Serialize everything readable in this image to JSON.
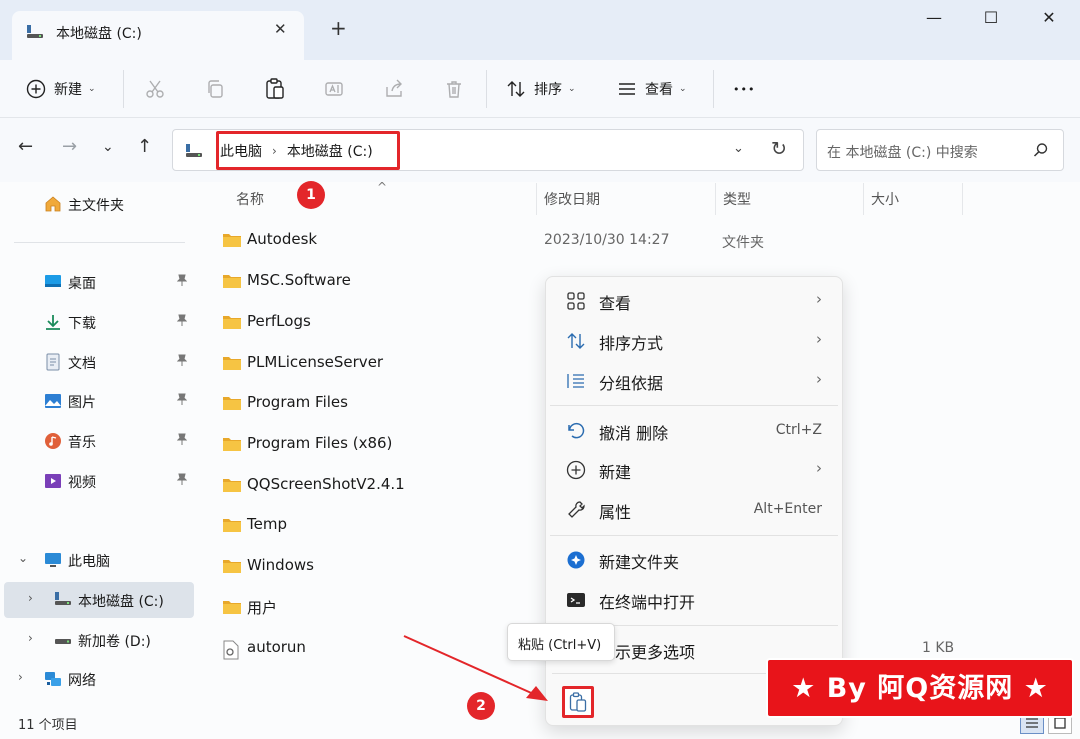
{
  "window": {
    "tab_title": "本地磁盘 (C:)",
    "tab_close": "✕",
    "new_tab": "+",
    "minimize": "—",
    "maximize": "☐",
    "close": "✕"
  },
  "toolbar": {
    "new_label": "新建",
    "sort_label": "排序",
    "view_label": "查看",
    "more_label": "•••",
    "caret": "⌄",
    "disabled_buttons": [
      "cut-icon",
      "copy-icon",
      "rename-icon",
      "share-icon",
      "delete-icon"
    ],
    "enabled_buttons": [
      "paste-icon"
    ]
  },
  "nav": {
    "back": "←",
    "forward": "→",
    "recent": "⌄",
    "up": "↑"
  },
  "address": {
    "crumbs": [
      "此电脑",
      "本地磁盘 (C:)"
    ],
    "separator": "›",
    "dropdown": "⌄",
    "refresh": "↻"
  },
  "search": {
    "placeholder": "在 本地磁盘 (C:) 中搜索"
  },
  "sidebar": {
    "home": "主文件夹",
    "quick": [
      {
        "label": "桌面",
        "icon": "desktop-icon"
      },
      {
        "label": "下载",
        "icon": "download-icon"
      },
      {
        "label": "文档",
        "icon": "document-icon"
      },
      {
        "label": "图片",
        "icon": "pictures-icon"
      },
      {
        "label": "音乐",
        "icon": "music-icon"
      },
      {
        "label": "视频",
        "icon": "video-icon"
      }
    ],
    "pin": "📌",
    "this_pc": "此电脑",
    "drive_c": "本地磁盘 (C:)",
    "drive_d": "新加卷 (D:)",
    "network": "网络",
    "expand": "›",
    "collapse": "⌄"
  },
  "columns": {
    "name": "名称",
    "modified": "修改日期",
    "type": "类型",
    "size": "大小"
  },
  "files": [
    {
      "name": "Autodesk",
      "date": "2023/10/30 14:27",
      "type": "文件夹",
      "kind": "folder"
    },
    {
      "name": "MSC.Software",
      "date": "",
      "type": "",
      "kind": "folder"
    },
    {
      "name": "PerfLogs",
      "date": "",
      "type": "",
      "kind": "folder"
    },
    {
      "name": "PLMLicenseServer",
      "date": "",
      "type": "",
      "kind": "folder"
    },
    {
      "name": "Program Files",
      "date": "",
      "type": "",
      "kind": "folder"
    },
    {
      "name": "Program Files (x86)",
      "date": "",
      "type": "",
      "kind": "folder"
    },
    {
      "name": "QQScreenShotV2.4.1",
      "date": "",
      "type": "",
      "kind": "folder"
    },
    {
      "name": "Temp",
      "date": "",
      "type": "",
      "kind": "folder"
    },
    {
      "name": "Windows",
      "date": "",
      "type": "",
      "kind": "folder"
    },
    {
      "name": "用户",
      "date": "",
      "type": "",
      "kind": "folder"
    },
    {
      "name": "autorun",
      "date": "",
      "type": "",
      "kind": "file"
    }
  ],
  "autorun_size": "1 KB",
  "context_menu": {
    "items": [
      {
        "label": "查看",
        "shortcut": "",
        "submenu": true,
        "icon": "grid-view-icon"
      },
      {
        "label": "排序方式",
        "shortcut": "",
        "submenu": true,
        "icon": "sort-icon"
      },
      {
        "label": "分组依据",
        "shortcut": "",
        "submenu": true,
        "icon": "group-by-icon"
      },
      {
        "label": "撤消 删除",
        "shortcut": "Ctrl+Z",
        "submenu": false,
        "icon": "undo-icon"
      },
      {
        "label": "新建",
        "shortcut": "",
        "submenu": true,
        "icon": "new-icon"
      },
      {
        "label": "属性",
        "shortcut": "Alt+Enter",
        "submenu": false,
        "icon": "wrench-icon"
      },
      {
        "label": "新建文件夹",
        "shortcut": "",
        "submenu": false,
        "icon": "new-folder-icon"
      },
      {
        "label": "在终端中打开",
        "shortcut": "",
        "submenu": false,
        "icon": "terminal-icon"
      },
      {
        "label": "显示更多选项",
        "shortcut": "",
        "submenu": false,
        "icon": "more-options-icon"
      }
    ],
    "arrow": "›"
  },
  "tooltip": "粘贴 (Ctrl+V)",
  "status": {
    "count": "11 个项目"
  },
  "annotations": {
    "badge1": "1",
    "badge2": "2"
  },
  "watermark": "★ By 阿Q资源网 ★",
  "colors": {
    "accent_red": "#e3262a",
    "folder_yellow": "#f6c443",
    "selection": "#dde3ea"
  }
}
